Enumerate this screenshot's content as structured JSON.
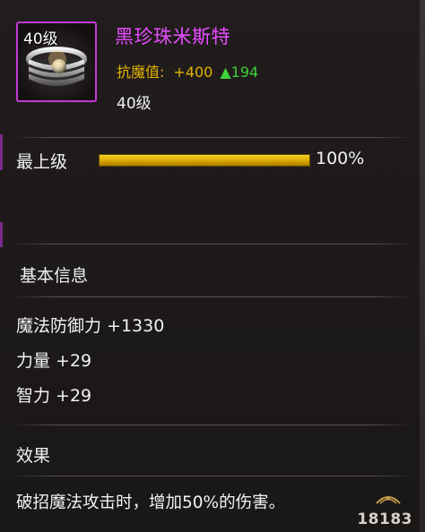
{
  "item": {
    "name": "黑珍珠米斯特",
    "icon_level": "40级",
    "icon": "ring-icon",
    "stat_label": "抗魔值:",
    "stat_value": "+400",
    "stat_up": "▲194",
    "level_text": "40级"
  },
  "grade": {
    "label": "最上级",
    "percent_text": "100%",
    "progress": 1.0
  },
  "basic_info": {
    "title": "基本信息",
    "props": [
      "魔法防御力 +1330",
      "力量 +29",
      "智力 +29"
    ]
  },
  "effect": {
    "title": "效果",
    "text": "破招魔法攻击时，增加50%的伤害。"
  },
  "watermark": {
    "text": "18183"
  },
  "colors": {
    "name": "#e64dff",
    "stat": "#e0b300",
    "up": "#3fd13a",
    "bar": "#d9a800",
    "frame": "#c23ad6"
  }
}
